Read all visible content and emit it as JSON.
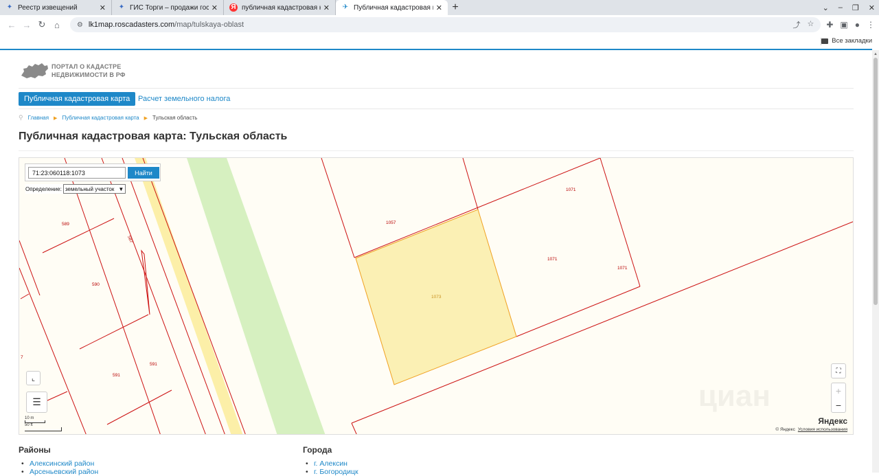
{
  "browser": {
    "tabs": [
      {
        "title": "Реестр извещений",
        "icon": "eagle-icon"
      },
      {
        "title": "ГИС Торги – продажи госуд",
        "icon": "eagle-icon"
      },
      {
        "title": "публичная кадастровая кар",
        "icon": "yandex-icon"
      },
      {
        "title": "Публичная кадастровая ка",
        "icon": "map-icon",
        "active": true
      }
    ],
    "url_host": "lk1map.roscadasters.com",
    "url_path": "/map/tulskaya-oblast",
    "bookmarks_all": "Все закладки"
  },
  "site": {
    "logo_line1": "ПОРТАЛ О КАДАСТРЕ",
    "logo_line2": "НЕДВИЖИМОСТИ В РФ",
    "menu": {
      "active": "Публичная кадастровая карта",
      "link": "Расчет земельного налога"
    },
    "breadcrumb": {
      "home": "Главная",
      "section": "Публичная кадастровая карта",
      "current": "Тульская область"
    },
    "page_title": "Публичная кадастровая карта: Тульская область"
  },
  "map": {
    "search_value": "71:23:060118:1073",
    "search_button": "Найти",
    "definition_label": "Определение:",
    "definition_value": "земельный участок",
    "parcel_labels": {
      "p589": "589",
      "p590": "590",
      "p591a": "591",
      "p591b": "591",
      "p587": "587",
      "p1057": "1057",
      "p1071a": "1071",
      "p1071b": "1071",
      "p1071c": "1071",
      "p1073": "1073",
      "edge7": "7"
    },
    "scale_m": "10 m",
    "scale_ft": "50 ft",
    "provider": "Яндекс",
    "copyright": "© Яндекс",
    "terms": "Условия использования",
    "watermark": "циан",
    "colors": {
      "selected_fill": "#fbf0b4",
      "selected_stroke": "#f0a020",
      "boundary": "#cc1111",
      "green_strip": "#d6f0c0",
      "yellow_strip": "#fcefa8"
    }
  },
  "lists": {
    "districts_title": "Районы",
    "districts": [
      "Алексинский район",
      "Арсеньевский район"
    ],
    "cities_title": "Города",
    "cities": [
      "г. Алексин",
      "г. Богородицк"
    ]
  }
}
